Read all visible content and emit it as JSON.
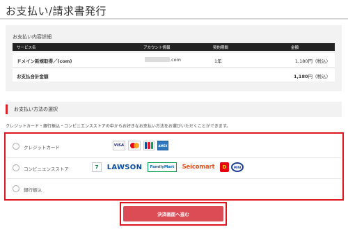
{
  "page": {
    "title": "お支払い/請求書発行"
  },
  "detail": {
    "heading": "お支払い内容詳細",
    "columns": [
      "サービス名",
      "アカウント情報",
      "契約期間",
      "金額"
    ],
    "rows": [
      {
        "service": "ドメイン新規取得／(com)",
        "account_suffix": ".com",
        "period": "1年",
        "amount": "1,180円（税込）"
      }
    ],
    "total": {
      "label": "お支払合計金額",
      "amount_number": "1,180",
      "amount_unit": "円（税込）"
    }
  },
  "methods": {
    "heading": "お支払い方法の選択",
    "description": "クレジットカード・銀行振込・コンビニエンスストアの中からお好きなお支払い方法をお選びいただくことができます。",
    "options": [
      {
        "label": "クレジットカード",
        "logos": [
          "VISA",
          "Mastercard",
          "JCB",
          "AMEX"
        ]
      },
      {
        "label": "コンビニエンスストア",
        "logos": [
          "7",
          "LAWSON",
          "FamilyMart",
          "Seicomart",
          "D",
          "MINI"
        ]
      },
      {
        "label": "銀行振込"
      }
    ]
  },
  "submit": {
    "label": "決済画面へ進む"
  },
  "colors": {
    "accent": "#e0161e",
    "button": "#dc4c55",
    "panel": "#f2f2f2"
  }
}
